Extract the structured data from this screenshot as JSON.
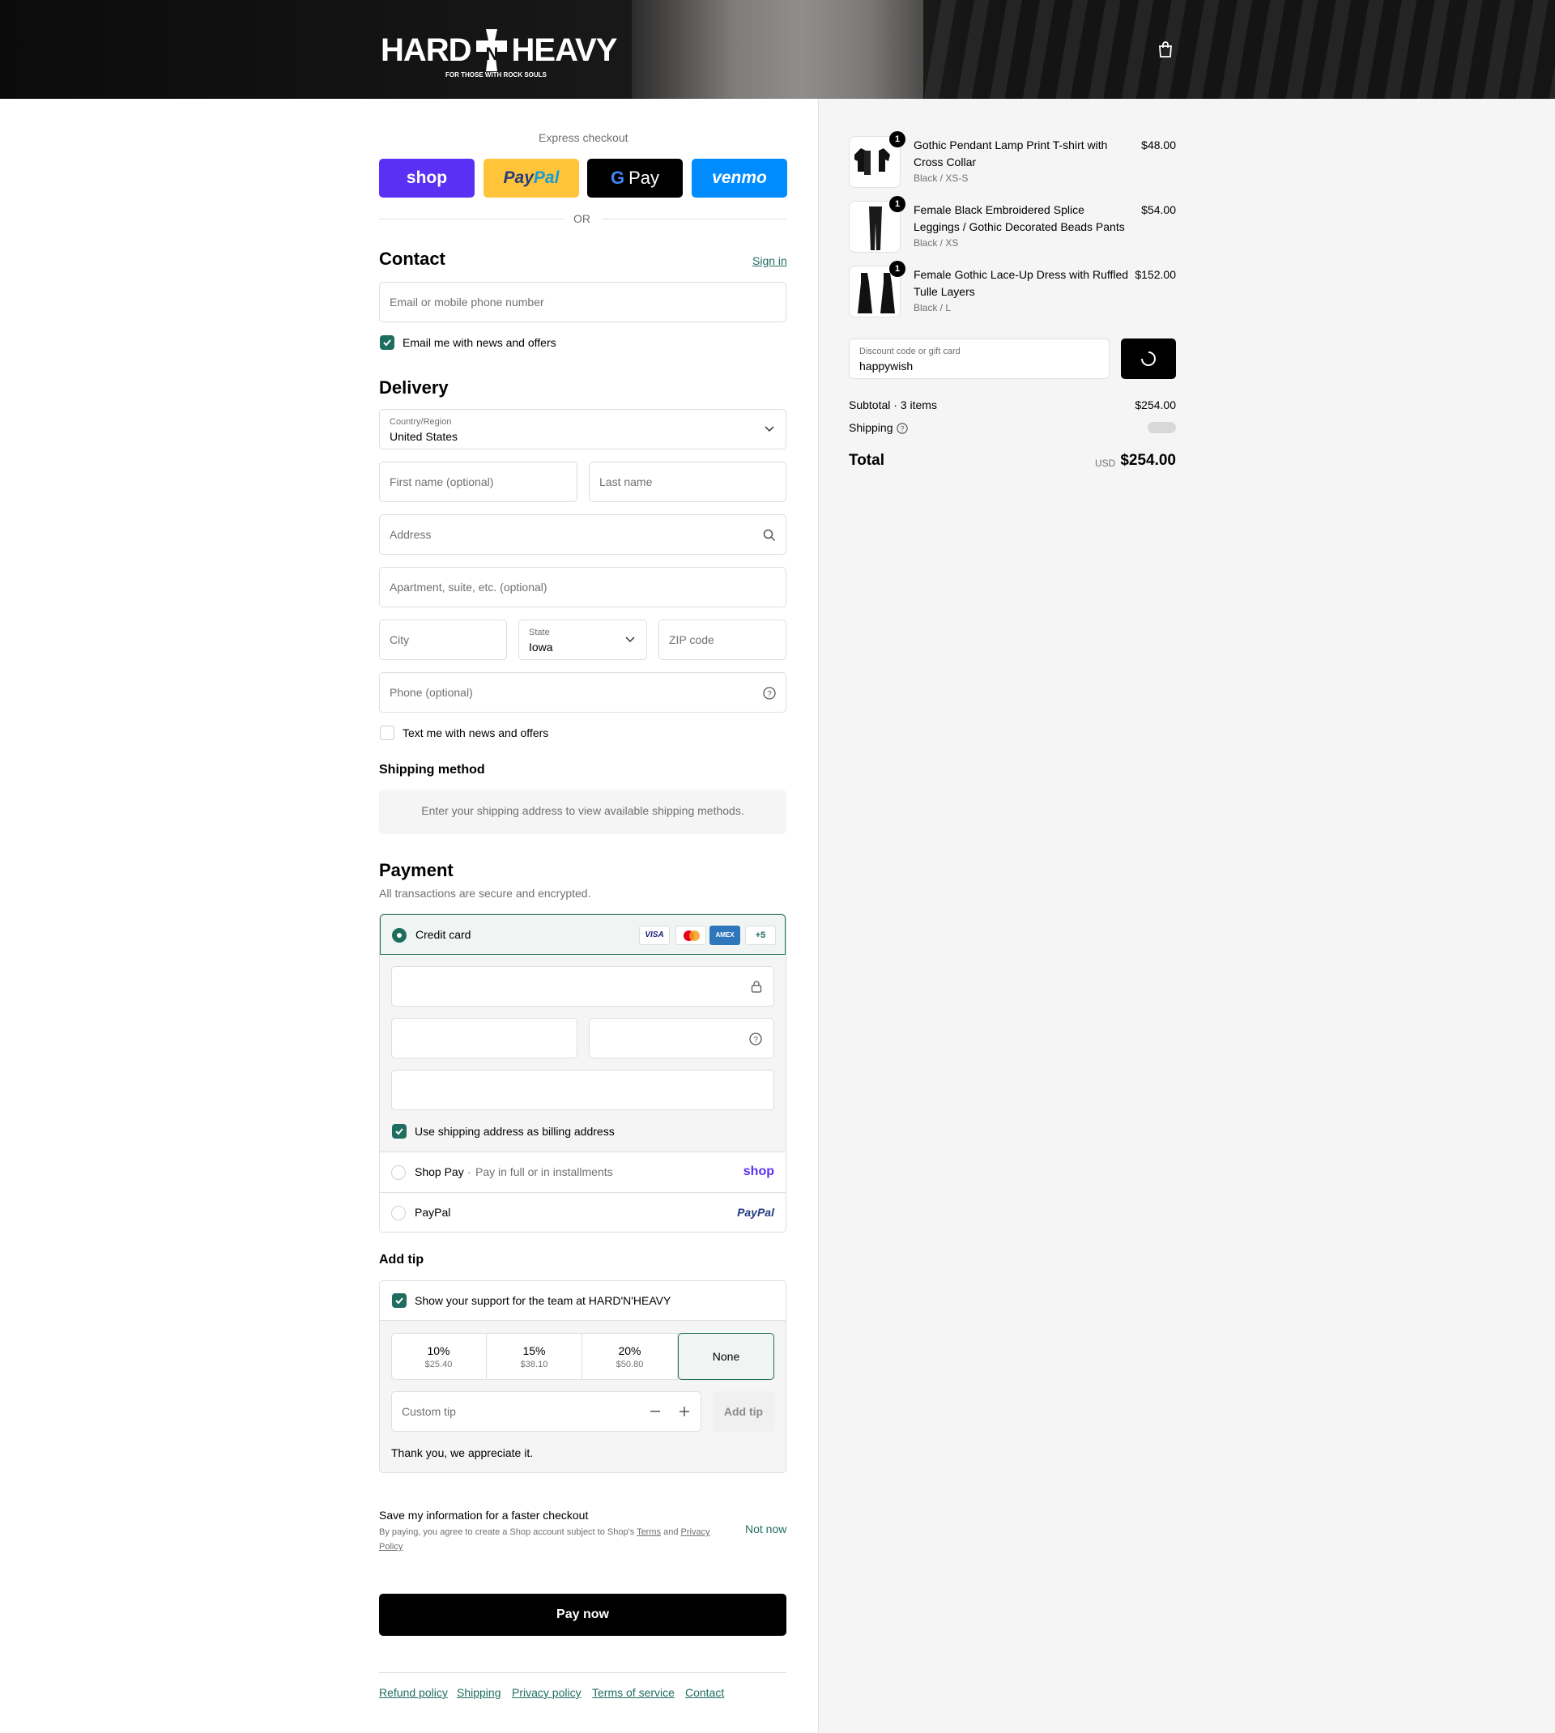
{
  "brand": {
    "logo_text_left": "HARD",
    "logo_text_right": "HEAVY",
    "tagline": "FOR THOSE WITH ROCK SOULS"
  },
  "express": {
    "title": "Express checkout",
    "or": "OR",
    "shop": "shop",
    "paypal": "PayPal",
    "gpay": "Pay",
    "venmo": "venmo"
  },
  "contact": {
    "heading": "Contact",
    "sign_in": "Sign in",
    "email_placeholder": "Email or mobile phone number",
    "news_label": "Email me with news and offers"
  },
  "delivery": {
    "heading": "Delivery",
    "country_label": "Country/Region",
    "country_value": "United States",
    "first_name": "First name (optional)",
    "last_name": "Last name",
    "address": "Address",
    "apartment": "Apartment, suite, etc. (optional)",
    "city": "City",
    "state_label": "State",
    "state_value": "Iowa",
    "zip": "ZIP code",
    "phone": "Phone (optional)",
    "text_label": "Text me with news and offers"
  },
  "shipping": {
    "heading": "Shipping method",
    "info": "Enter your shipping address to view available shipping methods."
  },
  "payment": {
    "heading": "Payment",
    "sub": "All transactions are secure and encrypted.",
    "credit_card": "Credit card",
    "more_cards": "+5",
    "visa": "VISA",
    "amex": "AMEX",
    "billing_label": "Use shipping address as billing address",
    "shoppay": "Shop Pay",
    "shoppay_sub": "Pay in full or in installments",
    "shoppay_logo": "shop",
    "paypal": "PayPal",
    "paypal_logo": "PayPal"
  },
  "tip": {
    "heading": "Add tip",
    "support_label": "Show your support for the team at HARD'N'HEAVY",
    "options": [
      {
        "percent": "10%",
        "amount": "$25.40"
      },
      {
        "percent": "15%",
        "amount": "$38.10"
      },
      {
        "percent": "20%",
        "amount": "$50.80"
      },
      {
        "percent": "None",
        "amount": ""
      }
    ],
    "custom_placeholder": "Custom tip",
    "add_button": "Add tip",
    "thanks": "Thank you, we appreciate it."
  },
  "save_info": {
    "title": "Save my information for a faster checkout",
    "desc_prefix": "By paying, you agree to create a Shop account subject to Shop's",
    "terms": "Terms",
    "and": "and",
    "privacy": "Privacy Policy",
    "not_now": "Not now"
  },
  "pay_button": "Pay now",
  "footer_links": [
    "Refund policy",
    "Shipping",
    "Privacy policy",
    "Terms of service",
    "Contact"
  ],
  "order": {
    "items": [
      {
        "qty": "1",
        "title": "Gothic Pendant Lamp Print T-shirt with Cross Collar",
        "variant": "Black / XS-S",
        "price": "$48.00"
      },
      {
        "qty": "1",
        "title": "Female Black Embroidered Splice Leggings / Gothic Decorated Beads Pants",
        "variant": "Black / XS",
        "price": "$54.00"
      },
      {
        "qty": "1",
        "title": "Female Gothic Lace-Up Dress with Ruffled Tulle Layers",
        "variant": "Black / L",
        "price": "$152.00"
      }
    ],
    "discount_label": "Discount code or gift card",
    "discount_value": "happywish",
    "subtotal_label": "Subtotal · 3 items",
    "subtotal": "$254.00",
    "shipping_label": "Shipping",
    "total_label": "Total",
    "currency": "USD",
    "total": "$254.00"
  },
  "colors": {
    "accent": "#1f6d5f",
    "shop": "#5a31f4",
    "paypal": "#ffc439",
    "venmo": "#008cff"
  }
}
